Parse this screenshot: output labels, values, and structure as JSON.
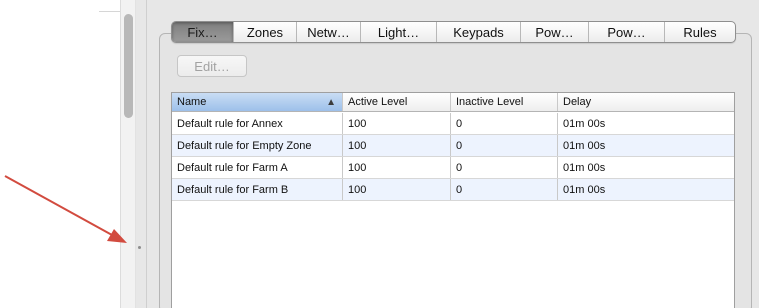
{
  "tabs": [
    {
      "label": "Fix…",
      "selected": true
    },
    {
      "label": "Zones",
      "selected": false
    },
    {
      "label": "Netw…",
      "selected": false
    },
    {
      "label": "Light…",
      "selected": false
    },
    {
      "label": "Keypads",
      "selected": false
    },
    {
      "label": "Pow…",
      "selected": false
    },
    {
      "label": "Pow…",
      "selected": false
    },
    {
      "label": "Rules",
      "selected": false
    }
  ],
  "toolbar": {
    "edit_label": "Edit…",
    "edit_enabled": false
  },
  "table": {
    "columns": [
      "Name",
      "Active Level",
      "Inactive Level",
      "Delay"
    ],
    "sorted_column": "Name",
    "sort_direction": "ascending",
    "rows": [
      [
        "Default rule for Annex",
        "100",
        "0",
        "01m 00s"
      ],
      [
        "Default rule for Empty Zone",
        "100",
        "0",
        "01m 00s"
      ],
      [
        "Default rule for Farm A",
        "100",
        "0",
        "01m 00s"
      ],
      [
        "Default rule for Farm B",
        "100",
        "0",
        "01m 00s"
      ]
    ]
  },
  "annotation": {
    "arrow_color": "#d24b3f"
  },
  "colors": {
    "selected_tab": "#8a8a8a",
    "sorted_header": "#a9c7ec",
    "alt_row": "#edf3fe"
  }
}
